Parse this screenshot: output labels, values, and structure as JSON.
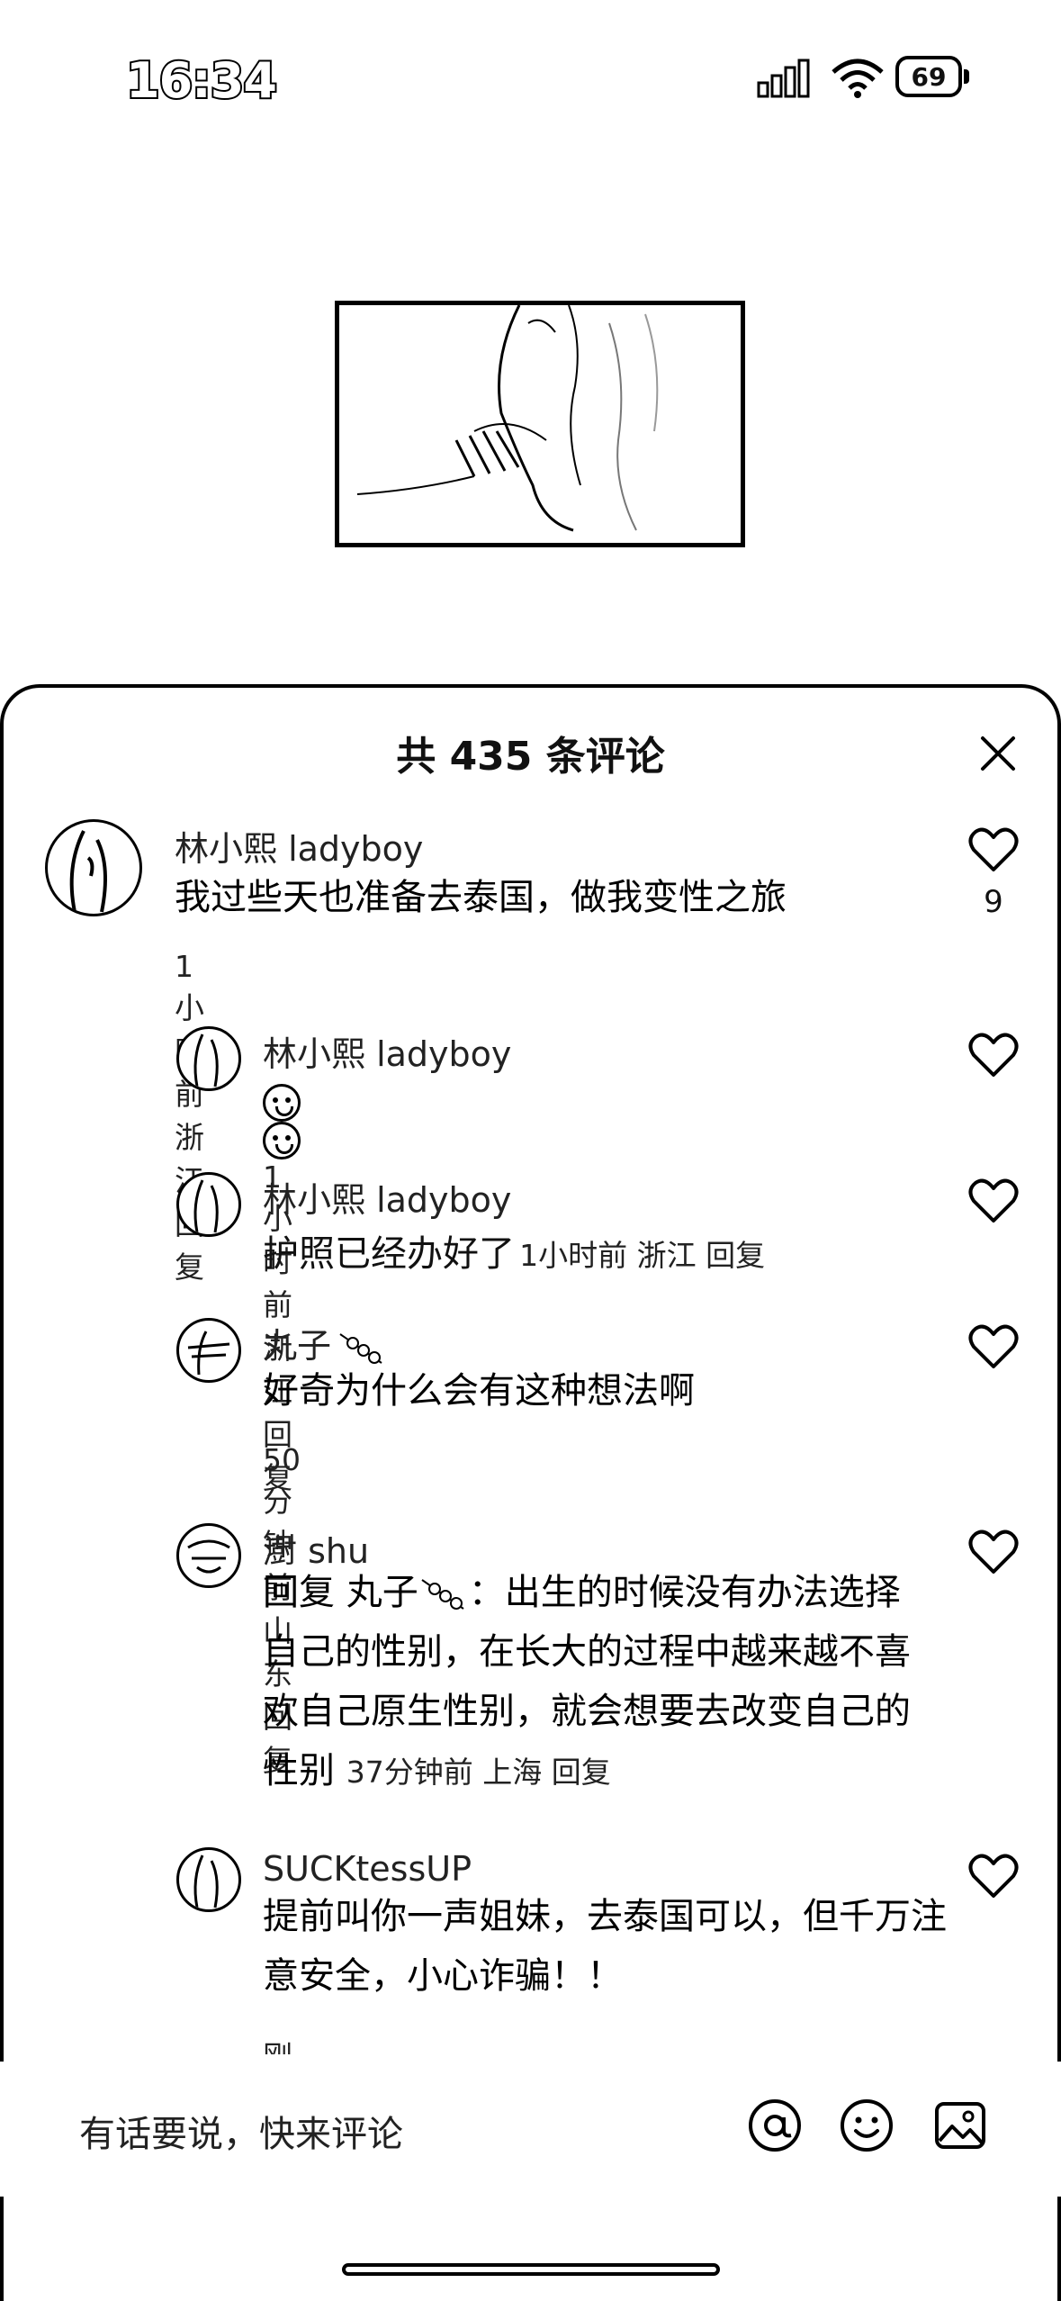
{
  "status_bar": {
    "time": "16:34",
    "battery": "69"
  },
  "sheet": {
    "title": "共 435 条评论",
    "input_placeholder": "有话要说，快来评论"
  },
  "comments": [
    {
      "name": "林小熙 ladyboy",
      "text": "我过些天也准备去泰国，做我变性之旅",
      "meta": "1小时前 浙江 回复",
      "likes": "9"
    },
    {
      "name": "林小熙 ladyboy",
      "text": "",
      "meta": "1小时前 浙江 回复"
    },
    {
      "name": "林小熙 ladyboy",
      "text": "护照已经办好了",
      "meta": "1小时前 浙江 回复"
    },
    {
      "name": "丸子",
      "text": "好奇为什么会有这种想法啊",
      "meta": "50分钟前 山东 回复"
    },
    {
      "name": "澍 shu",
      "reply_prefix": "回复 丸子",
      "text": "：出生的时候没有办法选择自己的性别，在长大的过程中越来越不喜欢自己原生性别，就会想要去改变自己的性别",
      "meta": "37分钟前 上海 回复"
    },
    {
      "name": "SUCKtessUP",
      "text": "提前叫你一声姐妹，去泰国可以，但千万注意安全，小心诈骗！！",
      "meta": "刚刚 山西 回复"
    }
  ]
}
